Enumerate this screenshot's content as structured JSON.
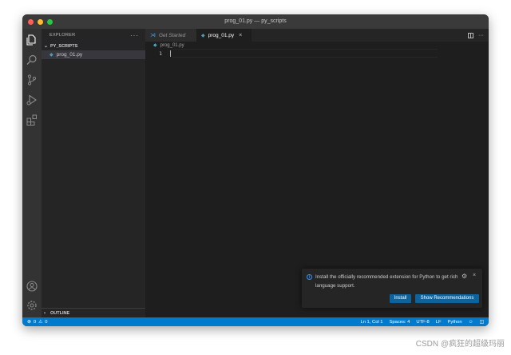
{
  "window": {
    "title": "prog_01.py — py_scripts"
  },
  "activity_bar": {
    "icons": [
      "files-icon",
      "search-icon",
      "source-control-icon",
      "run-debug-icon",
      "extensions-icon",
      "account-icon",
      "settings-gear-icon"
    ]
  },
  "sidebar": {
    "header": "EXPLORER",
    "more": "···",
    "folder": "PY_SCRIPTS",
    "files": [
      {
        "name": "prog_01.py",
        "icon": "python-file-icon"
      }
    ],
    "outline": "OUTLINE"
  },
  "tabs": [
    {
      "label": "Get Started",
      "icon": "vscode-icon",
      "active": false
    },
    {
      "label": "prog_01.py",
      "icon": "python-file-icon",
      "active": true,
      "close": "×"
    }
  ],
  "tab_actions": {
    "more": "···"
  },
  "editor": {
    "breadcrumb": "prog_01.py",
    "lines": [
      {
        "number": "1",
        "text": ""
      }
    ]
  },
  "notification": {
    "info": "i",
    "message": "Install the officially recommended extension for Python to get rich language support.",
    "gear": "⚙",
    "close": "×",
    "buttons": {
      "install": "Install",
      "show_recommendations": "Show Recommendations"
    }
  },
  "statusbar": {
    "errors": "0",
    "warnings": "0",
    "position": "Ln 1, Col 1",
    "spaces": "Spaces: 4",
    "encoding": "UTF-8",
    "eol": "LF",
    "language": "Python"
  },
  "watermark": "CSDN @疯狂的超级玛丽",
  "colors": {
    "accent": "#007acc",
    "button": "#0e639c",
    "python_icon": "#519aba",
    "editor_bg": "#1e1e1e"
  }
}
